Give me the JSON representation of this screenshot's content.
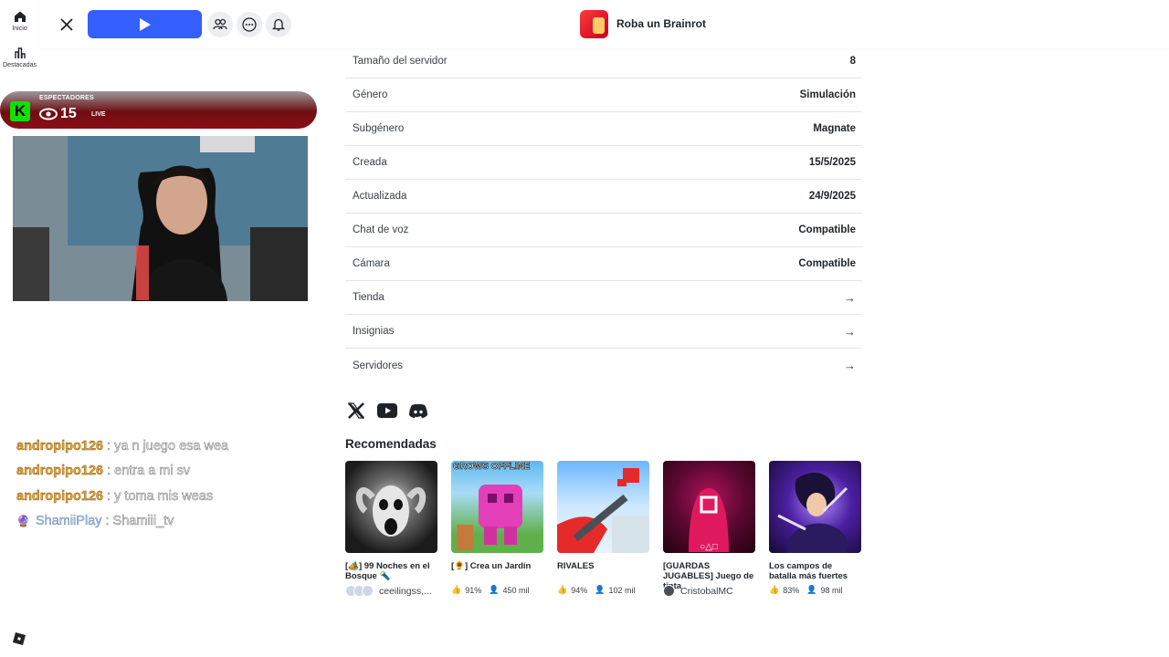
{
  "rail": {
    "items": [
      {
        "label": "Inicio",
        "icon": "home-icon"
      },
      {
        "label": "Destacadas",
        "icon": "charts-icon"
      }
    ]
  },
  "topbar": {
    "game_title": "Roba un Brainrot"
  },
  "info": {
    "rows": [
      {
        "key": "Tamaño del servidor",
        "value": "8"
      },
      {
        "key": "Género",
        "value": "Simulación"
      },
      {
        "key": "Subgénero",
        "value": "Magnate"
      },
      {
        "key": "Creada",
        "value": "15/5/2025"
      },
      {
        "key": "Actualizada",
        "value": "24/9/2025"
      },
      {
        "key": "Chat de voz",
        "value": "Compatible"
      },
      {
        "key": "Cámara",
        "value": "Compatible"
      },
      {
        "key": "Tienda",
        "value": "→"
      },
      {
        "key": "Insignias",
        "value": "→"
      },
      {
        "key": "Servidores",
        "value": "→"
      }
    ]
  },
  "recommended": {
    "title": "Recomendadas",
    "cards": [
      {
        "name": "[🏕️] 99 Noches en el Bosque 🔦",
        "creator": "ceeilingss,...",
        "rating": "",
        "players": "",
        "thumb_text": ""
      },
      {
        "name": "[🌻] Crea un Jardín",
        "creator": "",
        "rating": "91%",
        "players": "450 mil",
        "thumb_text": "GROWS OFFLINE"
      },
      {
        "name": "RIVALES",
        "creator": "",
        "rating": "94%",
        "players": "102 mil",
        "thumb_text": ""
      },
      {
        "name": "[GUARDAS JUGABLES] Juego de tinta",
        "creator": "CristobalMC",
        "rating": "",
        "players": "",
        "thumb_text": ""
      },
      {
        "name": "Los campos de batalla más fuertes",
        "creator": "",
        "rating": "83%",
        "players": "98 mil",
        "thumb_text": ""
      }
    ]
  },
  "stream": {
    "viewers_label": "ESPECTADORES",
    "viewers": "15",
    "live": "LIVE",
    "logo_letter": "K"
  },
  "chat": [
    {
      "user": "andropipo126",
      "msg": ": ya n juego esa wea"
    },
    {
      "user": "andropipo126",
      "msg": ": entra a mi sv"
    },
    {
      "user": "andropipo126",
      "msg": ": y toma mis weas"
    },
    {
      "user": "ShamiiPlay",
      "msg": ": Shamiii_tv"
    }
  ],
  "colors": {
    "play": "#335fff",
    "kick": "#13e000"
  }
}
